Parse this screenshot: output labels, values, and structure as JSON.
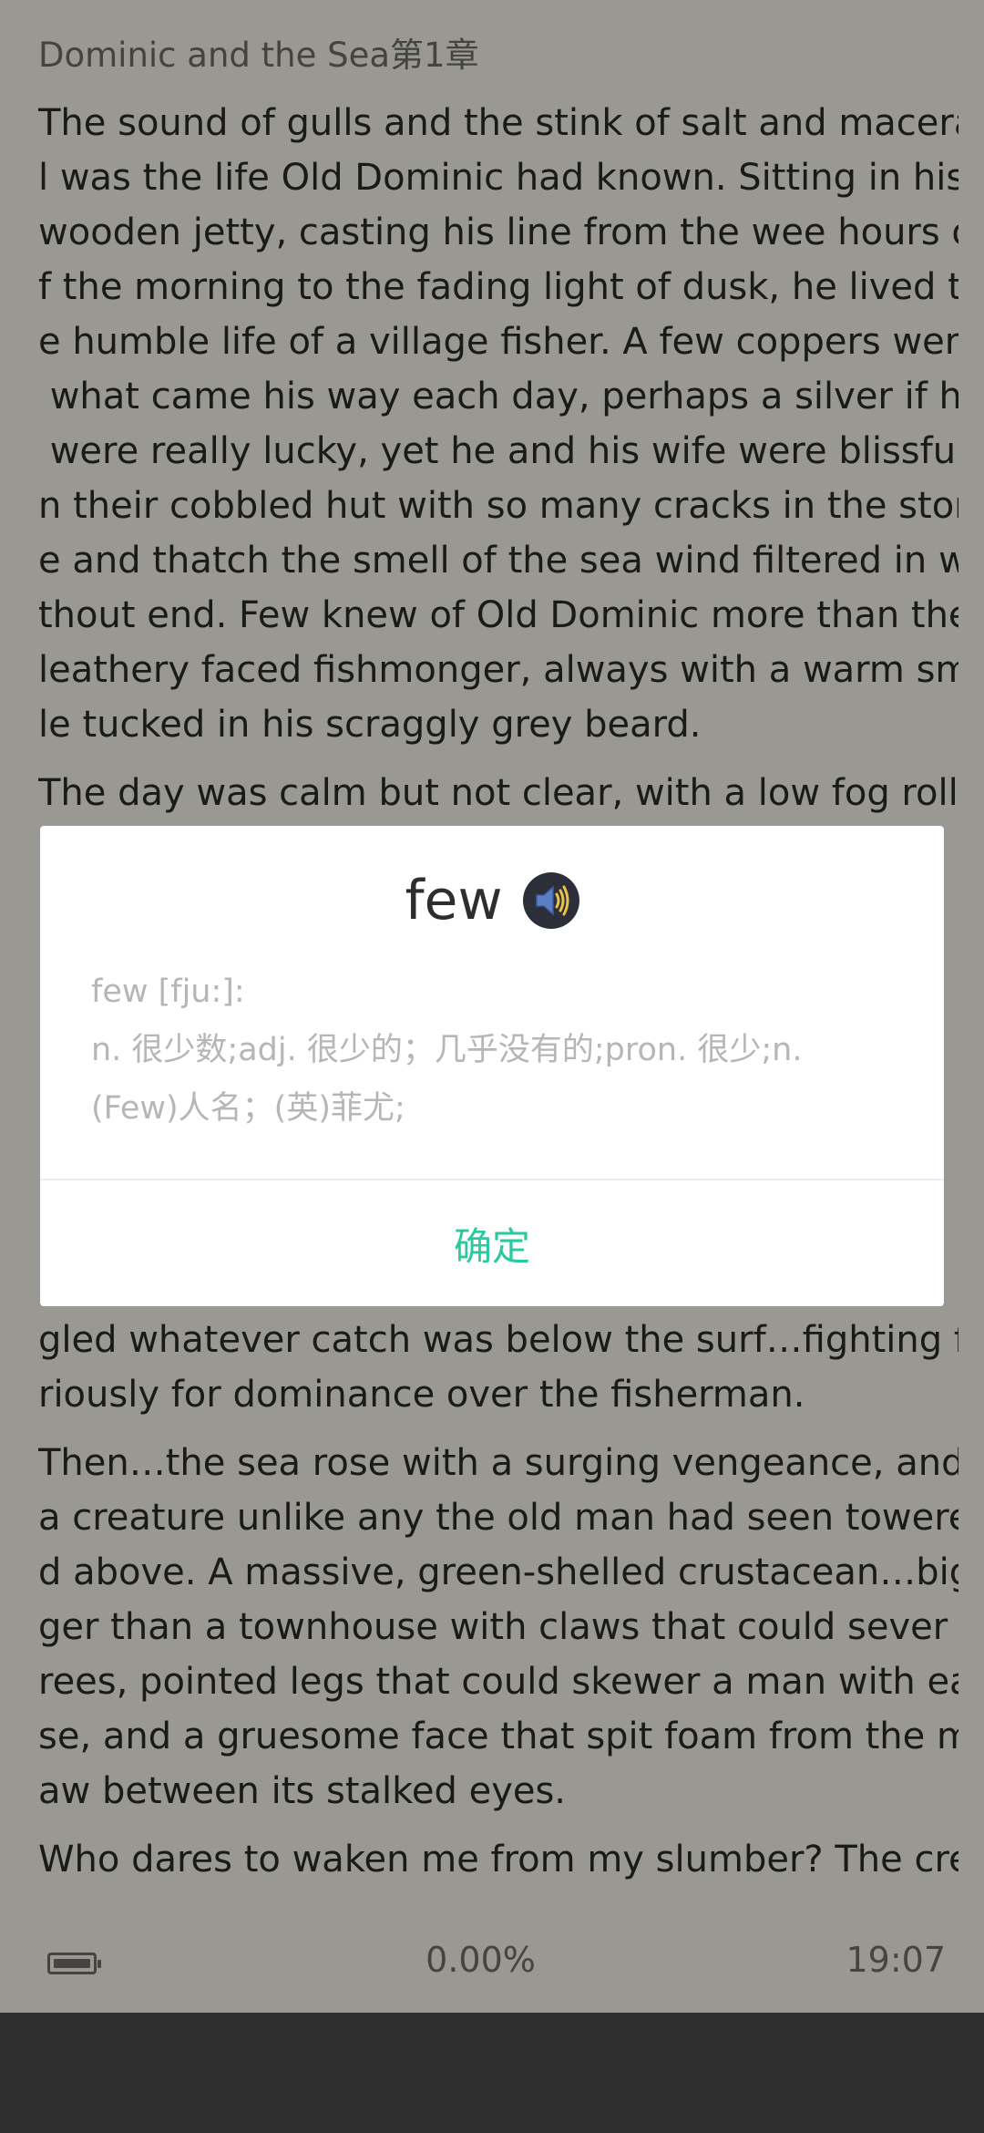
{
  "reader": {
    "chapter_title": "Dominic and the Sea第1章",
    "lines": [
      "The sound of gulls and the stink of salt and macera-",
      "l was the life Old Dominic had known. Sitting in his",
      "wooden jetty, casting his line from the wee hours o-",
      "f the morning to the fading light of dusk, he lived th-",
      "e humble life of a village fisher. A few coppers were",
      " what came his way each day, perhaps a silver if he",
      " were really lucky, yet he and his wife were blissful i-",
      "n their cobbled hut with so many cracks in the ston-",
      "e and thatch the smell of the sea wind filtered in wi-",
      "thout end. Few knew of Old Dominic more than the",
      "leathery faced fishmonger, always with a warm smi-",
      "le tucked in his scraggly grey beard.",
      "The day was calm but not clear, with a low fog rolli-",
      "gled whatever catch was below the surf…fighting fu-",
      "riously for dominance over the fisherman.",
      "Then…the sea rose with a surging vengeance, and",
      "a creature unlike any the old man had seen towere-",
      "d above. A massive, green-shelled crustacean…big-",
      "ger than a townhouse with claws that could sever t-",
      "rees, pointed legs that could skewer a man with ea-",
      "se, and a gruesome face that spit foam from the m-",
      "aw between its stalked eyes.",
      "Who dares to waken me from my slumber? The cre"
    ],
    "footer": {
      "progress": "0.00%",
      "time": "19:07",
      "battery_icon": "battery-icon"
    }
  },
  "dialog": {
    "word": "few",
    "speaker_icon": "speaker-icon",
    "definition_lines": [
      "few [fju:]:",
      "n. 很少数;adj. 很少的；几乎没有的;pron. 很少;n.",
      "(Few)人名；(英)菲尤;"
    ],
    "confirm_label": "确定"
  },
  "colors": {
    "accent": "#2bc9a0",
    "paper": "#f0eee4",
    "text": "#2a2a28"
  }
}
